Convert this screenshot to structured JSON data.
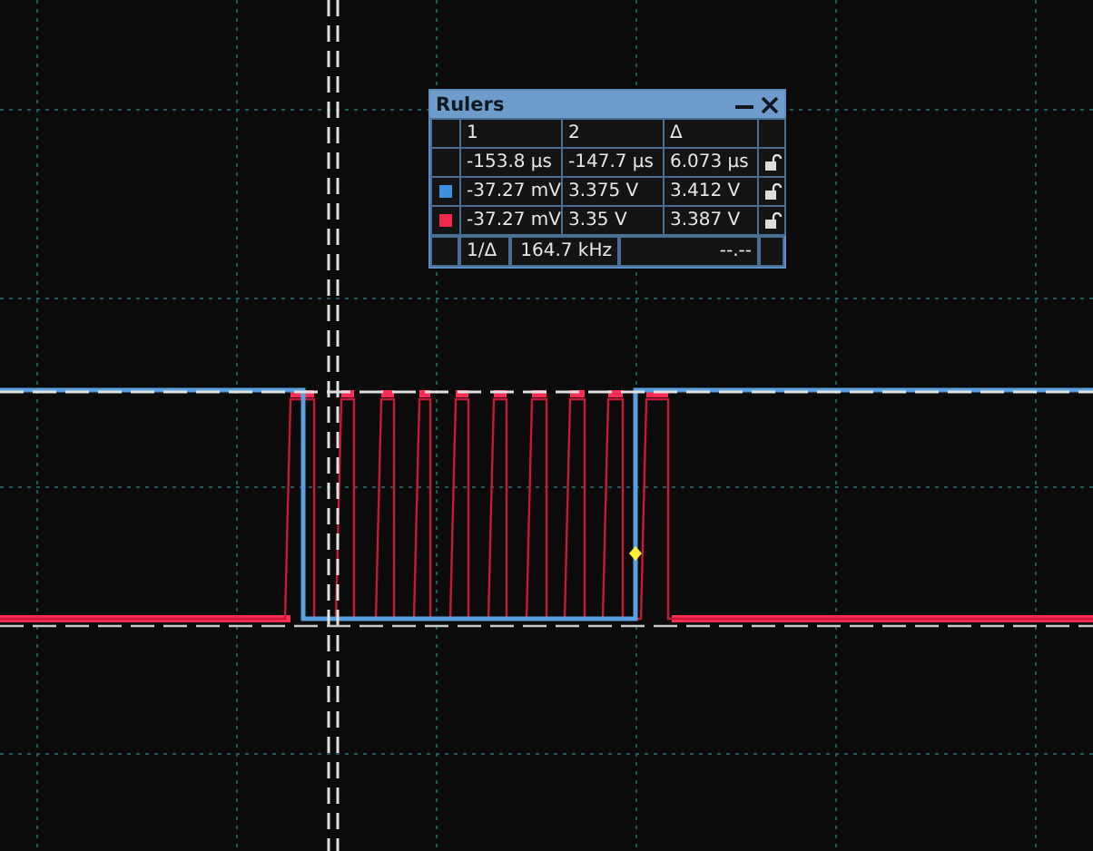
{
  "rulers": {
    "title": "Rulers",
    "columns": [
      "1",
      "2",
      "Δ"
    ],
    "rows": [
      {
        "kind": "time",
        "cells": [
          "-153.8 µs",
          "-147.7 µs",
          "6.073 µs"
        ]
      },
      {
        "kind": "channel",
        "color": "#3d8fe0",
        "cells": [
          "-37.27 mV",
          "3.375 V",
          "3.412 V"
        ]
      },
      {
        "kind": "channel",
        "color": "#f0284a",
        "cells": [
          "-37.27 mV",
          "3.35 V",
          "3.387 V"
        ]
      }
    ],
    "footer": {
      "label": "1/Δ",
      "value": "164.7 kHz",
      "reading": "--.--"
    }
  }
}
